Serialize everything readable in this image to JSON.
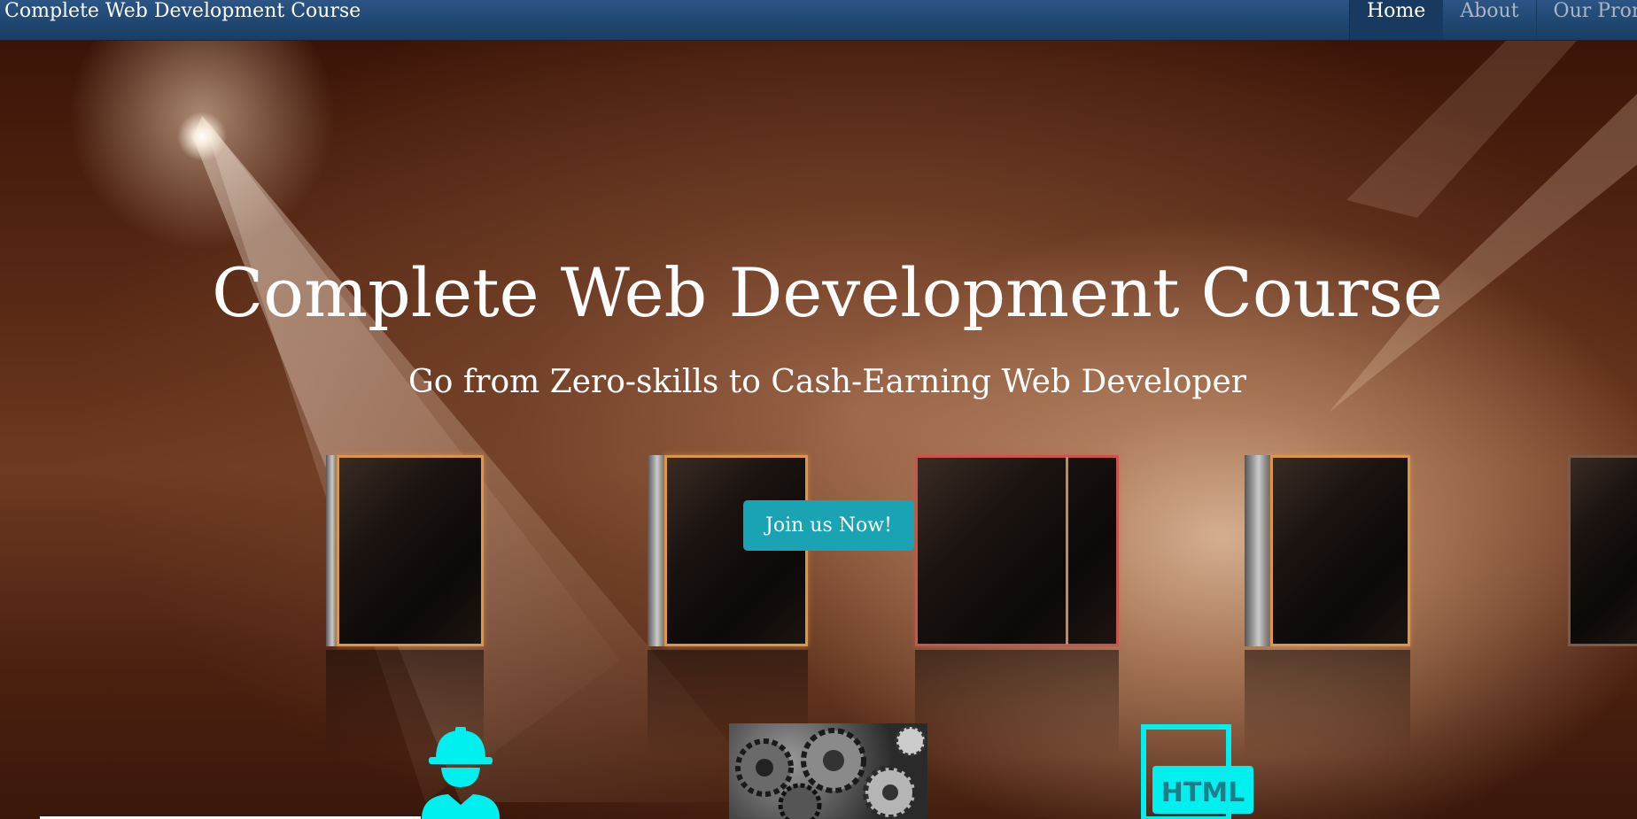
{
  "navbar": {
    "brand": "Complete Web Development Course",
    "links": [
      {
        "label": "Home",
        "active": true
      },
      {
        "label": "About",
        "active": false
      },
      {
        "label": "Our Promise",
        "active": false
      }
    ]
  },
  "hero": {
    "title": "Complete Web Development Course",
    "subtitle": "Go from Zero-skills to Cash-Earning Web Developer",
    "cta_label": "Join us Now!"
  },
  "features": {
    "icons": [
      "worker-helmet-icon",
      "gears-image",
      "html-icon"
    ],
    "html_icon_text": "HTML"
  },
  "colors": {
    "navbar": "#1f4670",
    "cta": "#1aa3b3",
    "feature_icon": "#00f0f0"
  }
}
